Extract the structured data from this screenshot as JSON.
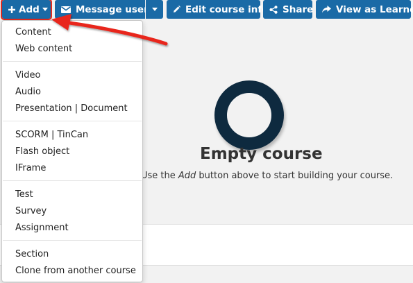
{
  "toolbar": {
    "add_label": "Add",
    "message_users_label": "Message users",
    "edit_course_label": "Edit course info",
    "share_label": "Share",
    "view_as_learner_label": "View as Learner"
  },
  "empty_state": {
    "title": "Empty course",
    "desc_prefix": "Use the ",
    "desc_emphasis": "Add",
    "desc_suffix": " button above to start building your course."
  },
  "add_menu": {
    "groups": [
      [
        "Content",
        "Web content"
      ],
      [
        "Video",
        "Audio",
        "Presentation | Document"
      ],
      [
        "SCORM | TinCan",
        "Flash object",
        "IFrame"
      ],
      [
        "Test",
        "Survey",
        "Assignment"
      ],
      [
        "Section",
        "Clone from another course"
      ]
    ]
  },
  "colors": {
    "button_blue": "#1a6aa6",
    "highlight_red": "#e02a1e",
    "ring_navy": "#0e2a3f"
  },
  "icons": {
    "add": "plus-icon",
    "message": "envelope-icon",
    "edit": "pencil-icon",
    "share": "share-icon",
    "view": "arrow-share-icon"
  }
}
